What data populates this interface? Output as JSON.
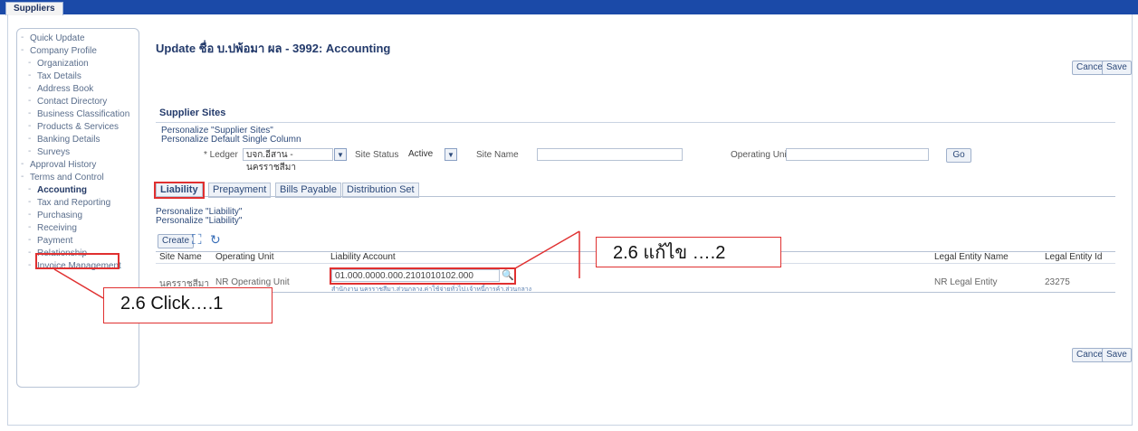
{
  "app": {
    "tab": "Suppliers"
  },
  "sidebar": {
    "items": [
      {
        "label": "Quick Update",
        "level": 0
      },
      {
        "label": "Company Profile",
        "level": 0
      },
      {
        "label": "Organization",
        "level": 1
      },
      {
        "label": "Tax Details",
        "level": 1
      },
      {
        "label": "Address Book",
        "level": 1
      },
      {
        "label": "Contact Directory",
        "level": 1
      },
      {
        "label": "Business Classification",
        "level": 1
      },
      {
        "label": "Products & Services",
        "level": 1
      },
      {
        "label": "Banking Details",
        "level": 1
      },
      {
        "label": "Surveys",
        "level": 1
      },
      {
        "label": "Approval History",
        "level": 0
      },
      {
        "label": "Terms and Control",
        "level": 0
      },
      {
        "label": "Accounting",
        "level": 1,
        "active": true
      },
      {
        "label": "Tax and Reporting",
        "level": 1
      },
      {
        "label": "Purchasing",
        "level": 1
      },
      {
        "label": "Receiving",
        "level": 1
      },
      {
        "label": "Payment",
        "level": 1
      },
      {
        "label": "Relationship",
        "level": 1
      },
      {
        "label": "Invoice Management",
        "level": 1
      }
    ]
  },
  "page": {
    "title": "Update ชื่อ บ.ปพ้อมา ผล - 3992: Accounting",
    "cancel": "Cancel",
    "save": "Save"
  },
  "supplier_sites": {
    "title": "Supplier Sites",
    "personalize1": "Personalize \"Supplier Sites\"",
    "personalize2": "Personalize Default Single Column",
    "ledger_label": "* Ledger",
    "ledger_value": "บจก.อีสาน - นครราชสีมา",
    "site_status_label": "Site Status",
    "site_status_value": "Active",
    "site_name_label": "Site Name",
    "operating_unit_label": "Operating Unit",
    "go": "Go"
  },
  "tabs": [
    "Liability",
    "Prepayment",
    "Bills Payable",
    "Distribution Set"
  ],
  "liability": {
    "personalize1": "Personalize \"Liability\"",
    "personalize2": "Personalize \"Liability\"",
    "create": "Create",
    "columns": [
      "Site Name",
      "Operating Unit",
      "Liability Account",
      "Legal Entity Name",
      "Legal Entity Id"
    ],
    "row": {
      "site_name": "นครราชสีมา",
      "operating_unit": "NR Operating Unit",
      "liability_account": "01.000.0000.000.2101010102.000",
      "account_desc": "สำนักงาน นครราชสีมา.ส่วนกลาง.ค่าใช้จ่ายทั่วไป.เจ้าหนี้การค้า.ส่วนกลาง",
      "legal_entity_name": "NR Legal Entity",
      "legal_entity_id": "23275"
    }
  },
  "annotations": {
    "callout1": "2.6 Click….1",
    "callout2": "2.6 แก้ไข ….2"
  }
}
